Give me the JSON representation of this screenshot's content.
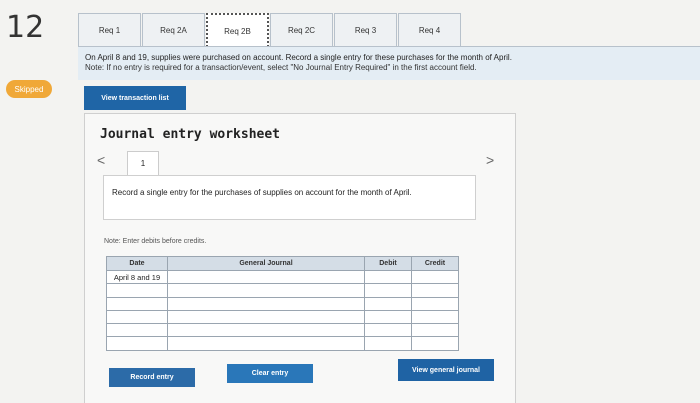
{
  "question_number": "12",
  "status_badge": "Skipped",
  "tabs": [
    {
      "label": "Req 1",
      "active": false
    },
    {
      "label": "Req 2A",
      "active": false
    },
    {
      "label": "Req 2B",
      "active": true
    },
    {
      "label": "Req 2C",
      "active": false
    },
    {
      "label": "Req 3",
      "active": false
    },
    {
      "label": "Req 4",
      "active": false
    }
  ],
  "instructions": {
    "line1": "On April 8 and 19, supplies were purchased on account. Record a single entry for these purchases for the month of April.",
    "line2": "Note: If no entry is required for a transaction/event, select \"No Journal Entry Required\" in the first account field."
  },
  "view_transaction_list_label": "View transaction list",
  "worksheet": {
    "title": "Journal entry worksheet",
    "nav_prev": "<",
    "nav_next": ">",
    "page": "1",
    "prompt": "Record a single entry for the purchases of supplies on account for the month of April.",
    "note": "Note: Enter debits before credits."
  },
  "journal_table": {
    "headers": {
      "date": "Date",
      "general_journal": "General Journal",
      "debit": "Debit",
      "credit": "Credit"
    },
    "rows": [
      {
        "date": "April 8 and 19",
        "account": "",
        "debit": "",
        "credit": ""
      },
      {
        "date": "",
        "account": "",
        "debit": "",
        "credit": ""
      },
      {
        "date": "",
        "account": "",
        "debit": "",
        "credit": ""
      },
      {
        "date": "",
        "account": "",
        "debit": "",
        "credit": ""
      },
      {
        "date": "",
        "account": "",
        "debit": "",
        "credit": ""
      },
      {
        "date": "",
        "account": "",
        "debit": "",
        "credit": ""
      }
    ]
  },
  "buttons": {
    "record_entry": "Record entry",
    "clear_entry": "Clear entry",
    "view_general_journal": "View general journal"
  },
  "colors": {
    "accent_blue": "#1f65a6",
    "skipped_orange": "#f0a838",
    "instruction_bg": "#e4edf4"
  }
}
